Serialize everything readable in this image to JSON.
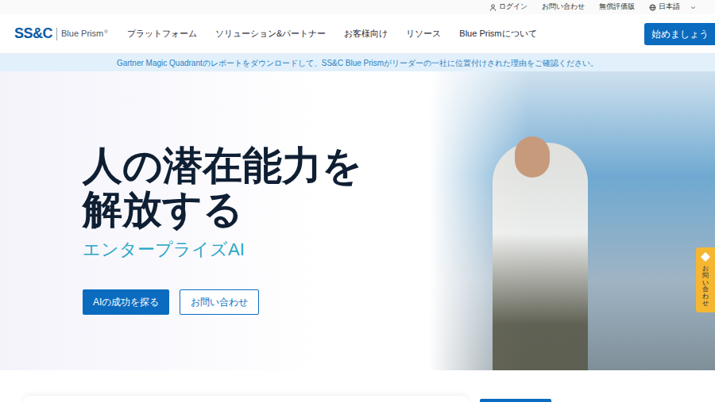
{
  "utility_bar": {
    "items": [
      "ログイン",
      "お問い合わせ",
      "無償評価版",
      "日本語"
    ]
  },
  "logo": {
    "mark": "SS&C",
    "product": "Blue Prism",
    "registered": "®"
  },
  "nav": {
    "items": [
      "プラットフォーム",
      "ソリューション&パートナー",
      "お客様向け",
      "リソース",
      "Blue Prismについて"
    ],
    "cta": "始めましょう"
  },
  "announcement": "Gartner Magic Quadrantのレポートをダウンロードして、SS&C Blue Prismがリーダーの一社に位置付けされた理由をご確認ください。",
  "hero": {
    "title_lines": [
      "人の潜在能力を",
      "解放する"
    ],
    "subtitle": "エンタープライズAI",
    "primary_button": "AIの成功を探る",
    "secondary_button": "お問い合わせ"
  },
  "side_tab": {
    "label": "お問い合わせ"
  }
}
